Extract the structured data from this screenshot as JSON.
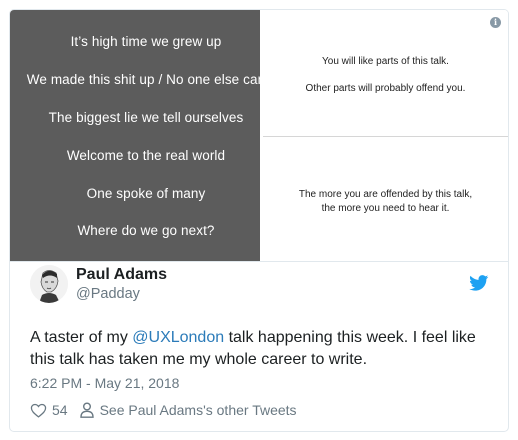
{
  "media": {
    "dark_slide_lines": [
      "It’s high time we grew up",
      "We made this shit up / No one else can",
      "The biggest lie we tell ourselves",
      "Welcome to the real world",
      "One spoke of many",
      "Where do we go next?"
    ],
    "top_slide_lines": [
      "You will like parts of this talk.",
      "Other parts will probably offend you."
    ],
    "bottom_slide_lines": [
      "The more you are offended by this talk,",
      "the more you need to hear it."
    ],
    "info_icon": "info-icon",
    "info_symbol": "i"
  },
  "author": {
    "display_name": "Paul Adams",
    "handle": "@Padday",
    "avatar_icon": "avatar"
  },
  "tweet": {
    "text_before": "A taster of my ",
    "mention": "@UXLondon",
    "text_after": " talk happening this week. I feel like this talk has taken me my whole career to write.",
    "timestamp": "6:22 PM - May 21, 2018"
  },
  "actions": {
    "like_count": "54",
    "profile_link": "See Paul Adams's other Tweets"
  },
  "colors": {
    "slide_dark": "#5c5c5c",
    "link": "#2b7bb9",
    "muted": "#697882",
    "twitter_blue": "#1da1f2"
  },
  "icons": [
    "info-icon",
    "twitter-bird-icon",
    "heart-icon",
    "person-icon"
  ]
}
